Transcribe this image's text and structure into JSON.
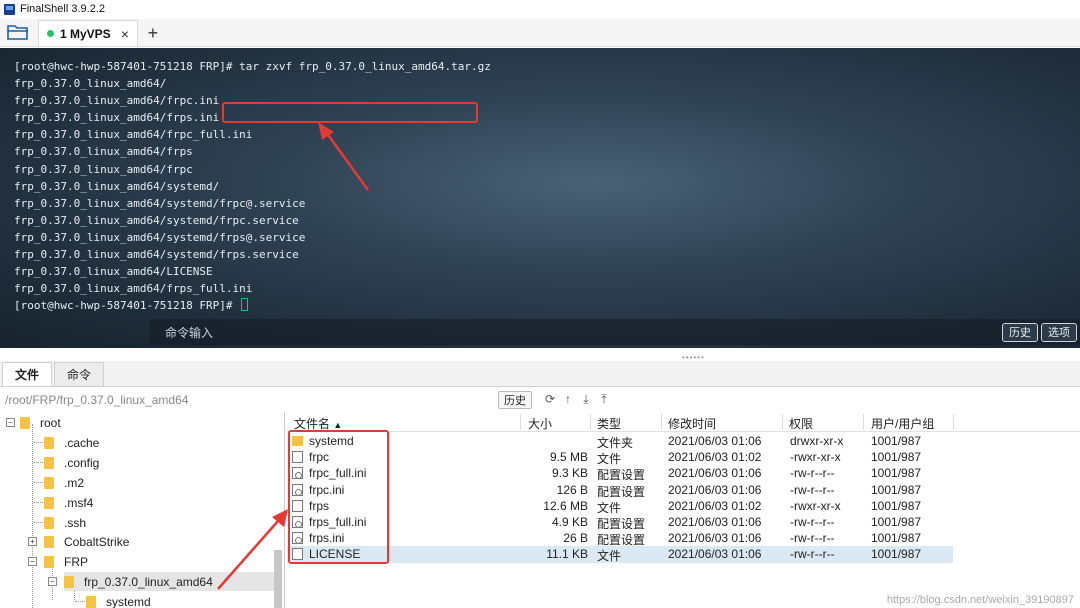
{
  "window": {
    "title": "FinalShell 3.9.2.2"
  },
  "tabs": {
    "active_label": "1 MyVPS",
    "close_glyph": "×",
    "add_glyph": "+"
  },
  "terminal": {
    "prompt": "[root@hwc-hwp-587401-751218 FRP]# ",
    "command": "tar zxvf frp_0.37.0_linux_amd64.tar.gz",
    "output": [
      "frp_0.37.0_linux_amd64/",
      "frp_0.37.0_linux_amd64/frpc.ini",
      "frp_0.37.0_linux_amd64/frps.ini",
      "frp_0.37.0_linux_amd64/frpc_full.ini",
      "frp_0.37.0_linux_amd64/frps",
      "frp_0.37.0_linux_amd64/frpc",
      "frp_0.37.0_linux_amd64/systemd/",
      "frp_0.37.0_linux_amd64/systemd/frpc@.service",
      "frp_0.37.0_linux_amd64/systemd/frpc.service",
      "frp_0.37.0_linux_amd64/systemd/frps@.service",
      "frp_0.37.0_linux_amd64/systemd/frps.service",
      "frp_0.37.0_linux_amd64/LICENSE",
      "frp_0.37.0_linux_amd64/frps_full.ini"
    ],
    "final_prompt": "[root@hwc-hwp-587401-751218 FRP]# ",
    "command_input_label": "命令输入",
    "history_button": "历史",
    "options_button": "选项"
  },
  "bottom_tabs": {
    "files": "文件",
    "commands": "命令"
  },
  "pathbar": {
    "path": "/root/FRP/frp_0.37.0_linux_amd64",
    "history_button": "历史"
  },
  "tree": {
    "root": "root",
    "items": [
      ".cache",
      ".config",
      ".m2",
      ".msf4",
      ".ssh",
      "CobaltStrike",
      "FRP",
      "frp_0.37.0_linux_amd64",
      "systemd"
    ]
  },
  "file_table": {
    "headers": {
      "name": "文件名",
      "size": "大小",
      "type": "类型",
      "mtime": "修改时间",
      "perm": "权限",
      "owner": "用户/用户组",
      "sort_glyph": "▲"
    },
    "rows": [
      {
        "name": "systemd",
        "size": "",
        "type": "文件夹",
        "mtime": "2021/06/03 01:06",
        "perm": "drwxr-xr-x",
        "owner": "1001/987",
        "kind": "dir"
      },
      {
        "name": "frpc",
        "size": "9.5 MB",
        "type": "文件",
        "mtime": "2021/06/03 01:02",
        "perm": "-rwxr-xr-x",
        "owner": "1001/987",
        "kind": "file"
      },
      {
        "name": "frpc_full.ini",
        "size": "9.3 KB",
        "type": "配置设置",
        "mtime": "2021/06/03 01:06",
        "perm": "-rw-r--r--",
        "owner": "1001/987",
        "kind": "cfg"
      },
      {
        "name": "frpc.ini",
        "size": "126 B",
        "type": "配置设置",
        "mtime": "2021/06/03 01:06",
        "perm": "-rw-r--r--",
        "owner": "1001/987",
        "kind": "cfg"
      },
      {
        "name": "frps",
        "size": "12.6 MB",
        "type": "文件",
        "mtime": "2021/06/03 01:02",
        "perm": "-rwxr-xr-x",
        "owner": "1001/987",
        "kind": "file"
      },
      {
        "name": "frps_full.ini",
        "size": "4.9 KB",
        "type": "配置设置",
        "mtime": "2021/06/03 01:06",
        "perm": "-rw-r--r--",
        "owner": "1001/987",
        "kind": "cfg"
      },
      {
        "name": "frps.ini",
        "size": "26 B",
        "type": "配置设置",
        "mtime": "2021/06/03 01:06",
        "perm": "-rw-r--r--",
        "owner": "1001/987",
        "kind": "cfg"
      },
      {
        "name": "LICENSE",
        "size": "11.1 KB",
        "type": "文件",
        "mtime": "2021/06/03 01:06",
        "perm": "-rw-r--r--",
        "owner": "1001/987",
        "kind": "file"
      }
    ]
  },
  "watermark": "https://blog.csdn.net/weixin_39190897",
  "colors": {
    "highlight": "#e53935",
    "status_dot": "#22c55e",
    "folder": "#f6c244"
  }
}
